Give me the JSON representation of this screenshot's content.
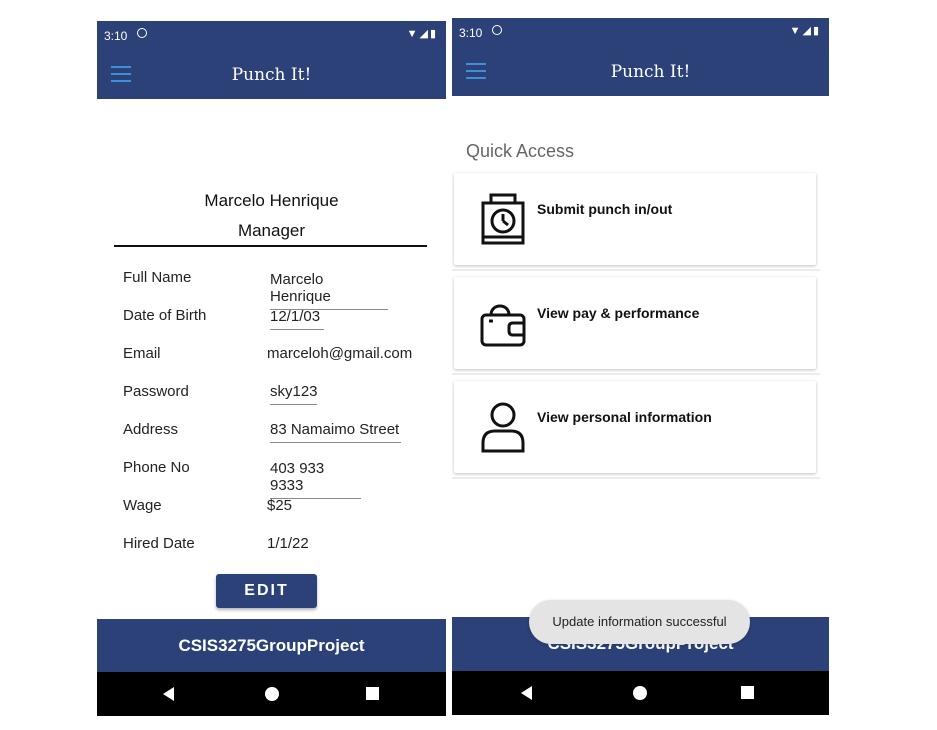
{
  "left_screen": {
    "status_bar": {
      "time": "3:10"
    },
    "toolbar": {
      "title": "Punch It!"
    },
    "profile": {
      "name": "Marcelo Henrique",
      "role": "Manager",
      "fields": [
        {
          "label": "Full Name",
          "value": "Marcelo Henrique"
        },
        {
          "label": "Date of Birth",
          "value": "12/1/03"
        },
        {
          "label": "Email",
          "value": "marceloh@gmail.com"
        },
        {
          "label": "Password",
          "value": "sky123"
        },
        {
          "label": "Address",
          "value": "83 Namaimo Street"
        },
        {
          "label": "Phone No",
          "value": "403 933 9333"
        },
        {
          "label": "Wage",
          "value": "$25"
        },
        {
          "label": "Hired Date",
          "value": "1/1/22"
        }
      ],
      "edit_label": "EDIT"
    },
    "footer": {
      "text": "CSIS3275GroupProject"
    }
  },
  "right_screen": {
    "status_bar": {
      "time": "3:10"
    },
    "toolbar": {
      "title": "Punch It!"
    },
    "quick_access": {
      "title": "Quick Access",
      "items": [
        {
          "label": "Submit punch in/out",
          "icon": "punch-clock-icon"
        },
        {
          "label": "View pay & performance",
          "icon": "wallet-icon"
        },
        {
          "label": "View personal information",
          "icon": "person-icon"
        }
      ]
    },
    "footer": {
      "text": "CSIS3275GroupProject"
    },
    "toast": {
      "message": "Update information successful"
    }
  },
  "colors": {
    "primary": "#2b4177",
    "hamburger": "#3f8fd6",
    "navbar": "#000000"
  }
}
